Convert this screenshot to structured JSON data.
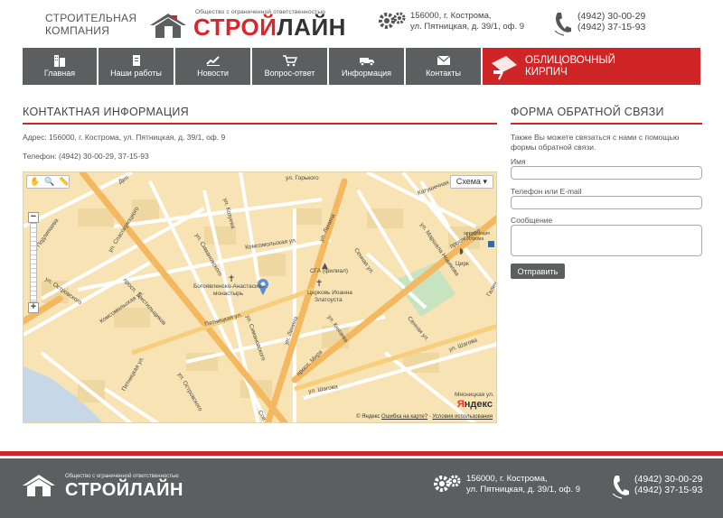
{
  "header": {
    "tagline_line1": "Строительная",
    "tagline_line2": "компания",
    "logo_small": "Общество с ограниченной ответственностью",
    "logo_part1": "СТРОЙ",
    "logo_part2": "ЛАЙН",
    "address_line1": "156000, г. Кострома,",
    "address_line2": "ул. Пятницкая, д. 39/1, оф. 9",
    "phone1": "(4942) 30-00-29",
    "phone2": "(4942) 37-15-93"
  },
  "nav": {
    "items": [
      {
        "label": "Главная",
        "icon": "building-icon"
      },
      {
        "label": "Наши работы",
        "icon": "document-icon"
      },
      {
        "label": "Новости",
        "icon": "chart-icon"
      },
      {
        "label": "Вопрос-ответ",
        "icon": "cart-icon"
      },
      {
        "label": "Информация",
        "icon": "truck-icon"
      },
      {
        "label": "Контакты",
        "icon": "envelope-icon"
      }
    ],
    "special_line1": "Облицовочный",
    "special_line2": "кирпич"
  },
  "contacts": {
    "title": "Контактная информация",
    "address": "Адрес: 156000, г. Кострома, ул. Пятницкая, д. 39/1, оф. 9",
    "phone": "Телефон: (4942) 30-00-29, 37-15-93"
  },
  "map": {
    "scheme_label": "Схема",
    "labels": {
      "gorkogo": "ул. Горького",
      "dep": "Деп",
      "sovetskaya": "ул. Советская",
      "lenina": "ул. Ленина",
      "katushechnaya": "Катушечная ул.",
      "podlipaeva": "ул. Подлипаева",
      "spasokukotskogo": "ул. Спасокукоцкого",
      "kozueva": "ул. Козуева",
      "simanovskogo": "ул. Симановского",
      "komsomolskaya": "Комсомольская ул.",
      "shagova_ul": "Ул.",
      "prosp_mira": "просп. Мира",
      "marshala": "ул. Маршала Новикова",
      "ostrovskogo": "ул. Островского",
      "prosp_tekstilshikov": "просп. Текстильщиков",
      "komsomolskaya2": "Комсомольская ул.",
      "monastery": "Богоявленско-Анастасиин",
      "monastery2": "монастырь",
      "sennaya": "Сенная ул.",
      "sga": "СГА (филиал)",
      "church": "Церковь Иоанна",
      "church2": "Златоуста",
      "tsirk": "Цирк",
      "avtostantsiya": "автостанция",
      "avtostantsiya2": "Кострома",
      "galich": "Галич",
      "pyatnitskaya": "Пятницкая ул.",
      "lenina2": "ул. Ленина",
      "knyazeva": "ул. Князева",
      "sennaya2": "Сенная ул.",
      "shagova": "ул. Шагова",
      "tekstilshikov2": "Сов",
      "ostrovskogo2": "ул. Островского",
      "pyatnitskaya2": "Пятницкая ул.",
      "prosp_mira2": "просп. Мира",
      "shagova2": "ул. Шагова",
      "myasnitskaya": "Мясницкая ул.",
      "chapaeva": "ул. Чапаева",
      "dep2": "ул. Деп",
      "ostrovskogo3": "ул. Островского"
    },
    "copyright": "© Яндекс",
    "error_link": "Ошибка на карте?",
    "terms_link": "Условия использования",
    "yandex_y": "Я",
    "yandex_rest": "ндекс"
  },
  "form": {
    "title": "Форма обратной связи",
    "intro": "Также Вы можете связаться с нами с помощью формы обратной связи.",
    "name_label": "Имя",
    "phone_label": "Телефон или E-mail",
    "message_label": "Сообщение",
    "submit_label": "Отправить"
  },
  "footer": {
    "logo_small": "Общество с ограниченной ответственностью",
    "logo_big": "СТРОЙЛАЙН",
    "address_line1": "156000, г. Кострома,",
    "address_line2": "ул. Пятницкая, д. 39/1, оф. 9",
    "phone1": "(4942) 30-00-29",
    "phone2": "(4942) 37-15-93"
  },
  "colors": {
    "accent": "#d02527",
    "nav_bg": "#5d5e60",
    "map_bg": "#f7e3b4",
    "road_major": "#f4b860"
  }
}
